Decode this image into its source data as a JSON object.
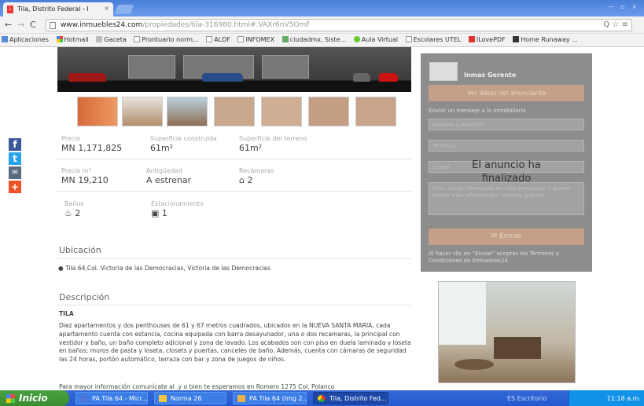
{
  "browser": {
    "tab_title": "Tila, Distrito Federal - I",
    "tab_close": "×",
    "window_controls": "— ▫ ×",
    "url_host": "www.inmuebles24.com",
    "url_path": "/propiedades/tila-316980.html#.VAXr6nV5OmF",
    "url_actions": "Q ☆ ≡",
    "bookmarks": [
      "Aplicaciones",
      "Hotmail",
      "Gaceta",
      "Prontuario norm...",
      "ALDF",
      "INFOMEX",
      "ciudadmx, Siste...",
      "Aula Virtual",
      "Escolares UTEL",
      "ILovePDF",
      "Home Runaway ..."
    ]
  },
  "listing": {
    "specs": [
      {
        "label": "Precio",
        "value": "MN 1,171,825"
      },
      {
        "label": "Superficie construida",
        "value": "61m²"
      },
      {
        "label": "Superficie del terreno",
        "value": "61m²"
      },
      {
        "label": "Precio m²",
        "value": "MN 19,210"
      },
      {
        "label": "Antigüedad",
        "value": "A estrenar"
      },
      {
        "label": "Recámaras",
        "value": "2"
      },
      {
        "label": "Baños",
        "value": "2"
      },
      {
        "label": "Estacionamiento",
        "value": "1"
      }
    ],
    "location_title": "Ubicación",
    "address": "Tila 64,Col. Victoria de las Democracias, Victoria de las Democracias",
    "description_title": "Descripción",
    "description_heading": "TILA",
    "description_text": "Diez apartamentos y dos penthouses de 61 y 67 metros cuadrados, ubicados en la NUEVA SANTA MARIA, cada apartamento cuenta con estancia, cocina equipada con barra desayunador, una o dos recamaras, la principal con vestidor y baño, un baño completo adicional y zona de lavado. Los acabados son con piso en duela laminada y loseta en baños; muros de pasta y loseta, closets y puertas, canceles de baño. Además, cuenta con cámaras de seguridad las 24 horas, portón automático, terraza con bar y zona de juegos de niños.",
    "contact_text": "Para mayor información comunícate al .y o bien te esperamos en Romero 1275 Col. Polanco"
  },
  "contact_form": {
    "brand": "Inmas Gerente",
    "contact_button": "Ver datos del anunciante",
    "form_label": "Enviar un mensaje a la inmobiliaria",
    "name_placeholder": "Nombre y Apellido",
    "phone_placeholder": "Teléfono",
    "email_placeholder": "E-mail",
    "message_placeholder": "Hola, estoy interesado en esta propiedad y quiero recibir más información. Muchas gracias",
    "send_button": "✉ Enviar",
    "note": "Al hacer clic en \"Enviar\" aceptas los Términos y Condiciones de Inmuebles24",
    "ended_overlay": "El anuncio ha finalizado"
  },
  "taskbar": {
    "start_label": "Inicio",
    "tasks": [
      "PA Tila 64 - Micr...",
      "Norma 26",
      "PA Tila 64 (Img 2...",
      "Tila, Distrito Fed..."
    ],
    "language": "ES Escritorio",
    "clock": "11:18 a.m."
  }
}
